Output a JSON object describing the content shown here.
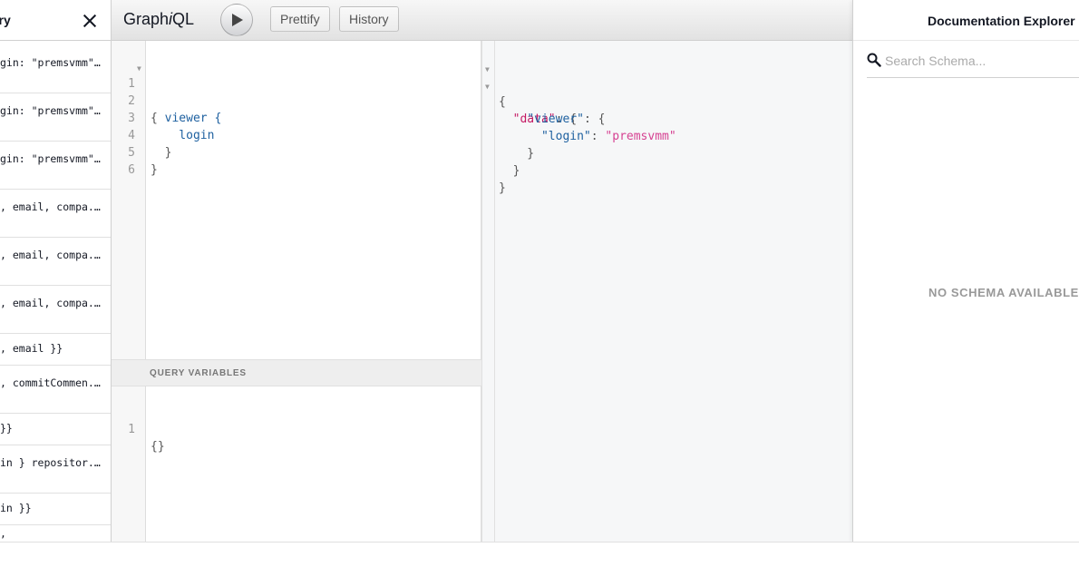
{
  "history": {
    "title": "ory",
    "items": [
      "gin: \"premsvmm\" ...",
      "gin: \"premsvmm\" ...",
      "gin: \"premsvmm\" ...",
      ", email, compa...",
      ", email, compa...",
      ", email, compa...",
      ", email }}",
      ", commitCommen...",
      " }}",
      "in } repositor...",
      "in }}",
      ","
    ]
  },
  "toolbar": {
    "logo_prefix": "Graph",
    "logo_italic": "i",
    "logo_suffix": "QL",
    "execute_icon": "play-icon",
    "prettify_label": "Prettify",
    "history_label": "History"
  },
  "query": {
    "line_numbers": [
      "1",
      "2",
      "3",
      "4",
      "5",
      "6"
    ],
    "lines": [
      "{",
      "  viewer {",
      "    login",
      "  }",
      "}",
      ""
    ]
  },
  "variables": {
    "title": "Query Variables",
    "line_numbers": [
      "1"
    ],
    "lines": [
      "{}"
    ]
  },
  "result": {
    "key_data": "\"data\"",
    "key_viewer": "\"viewer\"",
    "key_login": "\"login\"",
    "value_login": "\"premsvmm\""
  },
  "docs": {
    "title": "Documentation Explorer",
    "search_placeholder": "Search Schema...",
    "empty_message": "NO SCHEMA AVAILABLE"
  },
  "colors": {
    "field": "#1f61a0",
    "string": "#d64292",
    "key": "#c41a64"
  }
}
